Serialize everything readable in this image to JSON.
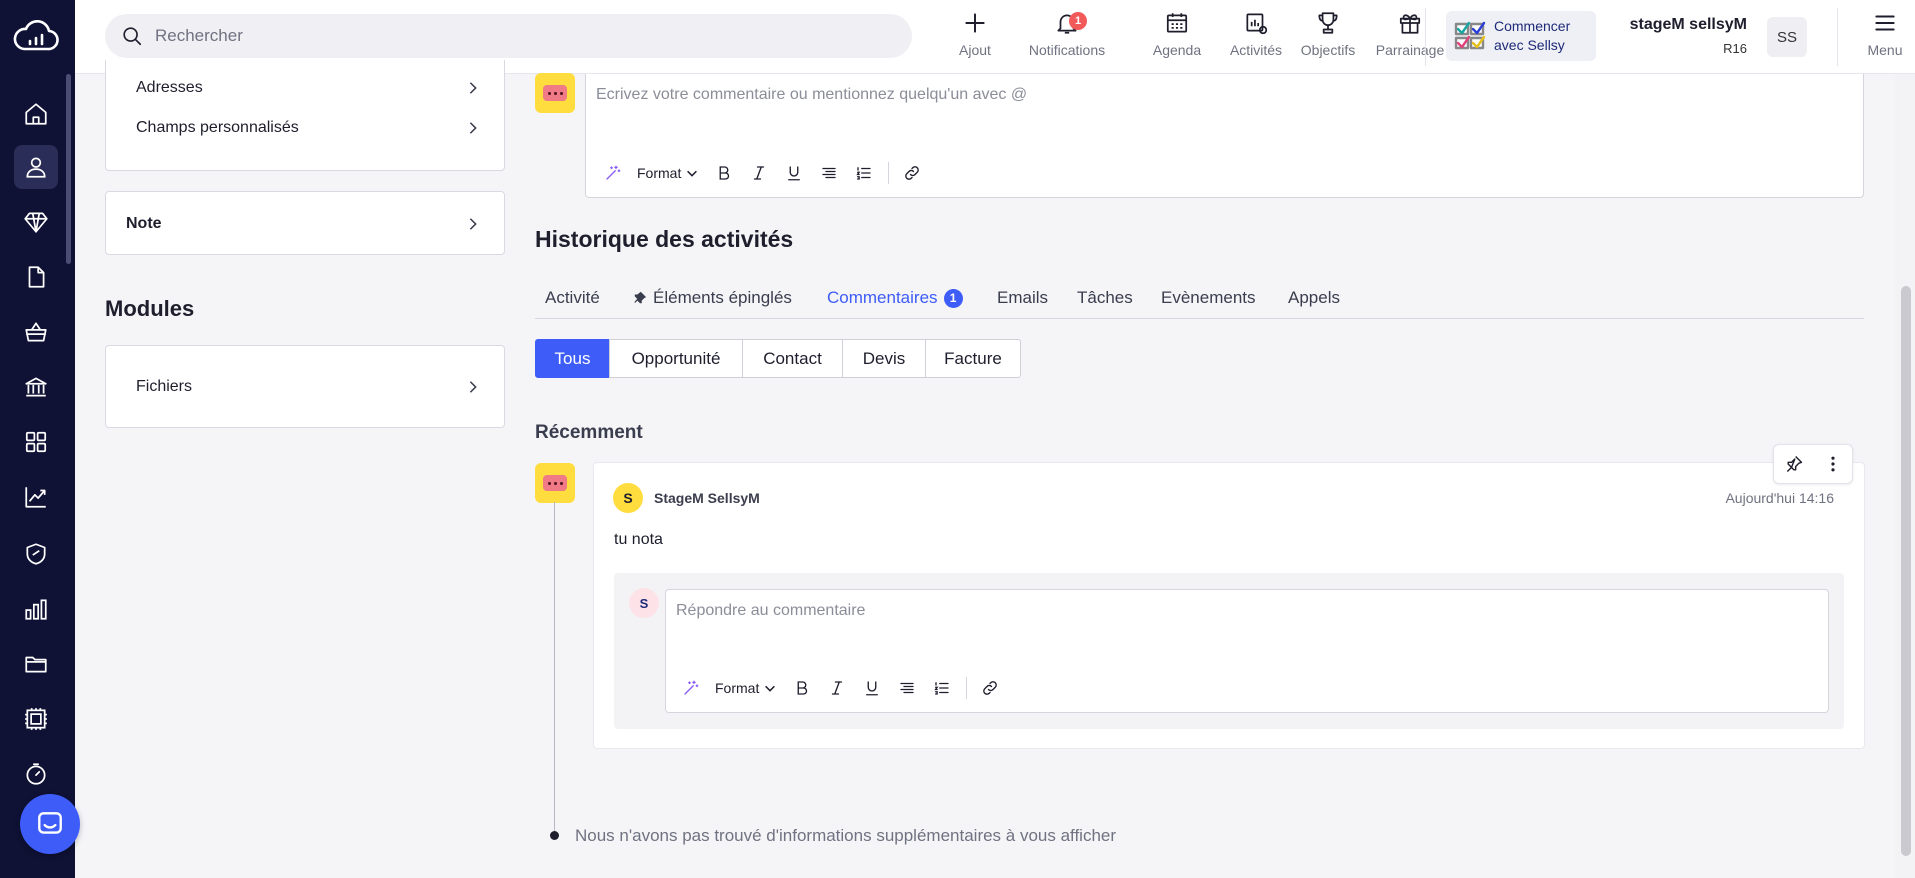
{
  "header": {
    "search_placeholder": "Rechercher",
    "buttons": [
      {
        "label": "Ajout",
        "icon": "plus-icon"
      },
      {
        "label": "Notifications",
        "icon": "bell-icon",
        "badge": "1"
      },
      {
        "label": "Agenda",
        "icon": "calendar-icon"
      },
      {
        "label": "Activités",
        "icon": "activities-icon"
      },
      {
        "label": "Objectifs",
        "icon": "trophy-icon"
      },
      {
        "label": "Parrainage",
        "icon": "gift-icon"
      }
    ],
    "start_card_label": "Commencer avec Sellsy",
    "user_name": "stageM sellsyM",
    "user_sub": "R16",
    "user_initials": "SS",
    "menu_label": "Menu"
  },
  "sidebar": {
    "icons": [
      "home-icon",
      "contacts-icon",
      "diamond-icon",
      "document-icon",
      "basket-icon",
      "bank-icon",
      "apps-icon",
      "chart-icon",
      "shield-icon",
      "bar-chart-icon",
      "folder-icon",
      "stamp-icon",
      "timer-icon"
    ],
    "active": "contacts-icon"
  },
  "left_panel": {
    "rows": [
      "Adresses",
      "Champs personnalisés"
    ],
    "note_label": "Note",
    "modules_title": "Modules",
    "files_label": "Fichiers"
  },
  "editor": {
    "placeholder": "Ecrivez votre commentaire ou mentionnez quelqu'un avec @",
    "format_label": "Format"
  },
  "history": {
    "title": "Historique des activités",
    "tabs": [
      {
        "label": "Activité"
      },
      {
        "label": "Éléments épinglés"
      },
      {
        "label": "Commentaires",
        "badge": "1",
        "active": true
      },
      {
        "label": "Emails"
      },
      {
        "label": "Tâches"
      },
      {
        "label": "Evènements"
      },
      {
        "label": "Appels"
      }
    ],
    "filters": [
      {
        "label": "Tous",
        "active": true
      },
      {
        "label": "Opportunité"
      },
      {
        "label": "Contact"
      },
      {
        "label": "Devis"
      },
      {
        "label": "Facture"
      }
    ],
    "recent_label": "Récemment",
    "comment": {
      "avatar_letter": "S",
      "author": "StageM SellsyM",
      "time": "Aujourd'hui 14:16",
      "text": "tu nota",
      "reply_avatar_letter": "S",
      "reply_placeholder": "Répondre au commentaire",
      "reply_format_label": "Format"
    },
    "no_more": "Nous n'avons pas trouvé d'informations supplémentaires à vous afficher"
  },
  "colors": {
    "sidebar_bg": "#0f1135",
    "accent": "#3e5cf7",
    "badge_red": "#f25a5a",
    "comment_icon_yellow": "#ffdd3f",
    "comment_icon_pink": "#f07a86"
  }
}
